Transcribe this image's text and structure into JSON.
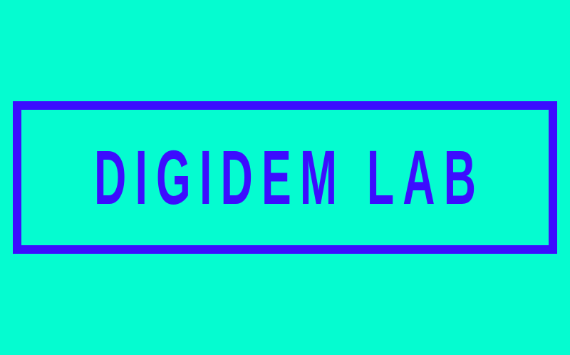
{
  "logo": {
    "text": "DIGIDEM LAB"
  },
  "colors": {
    "background": "#05FCD0",
    "accent": "#3C0CFF"
  }
}
